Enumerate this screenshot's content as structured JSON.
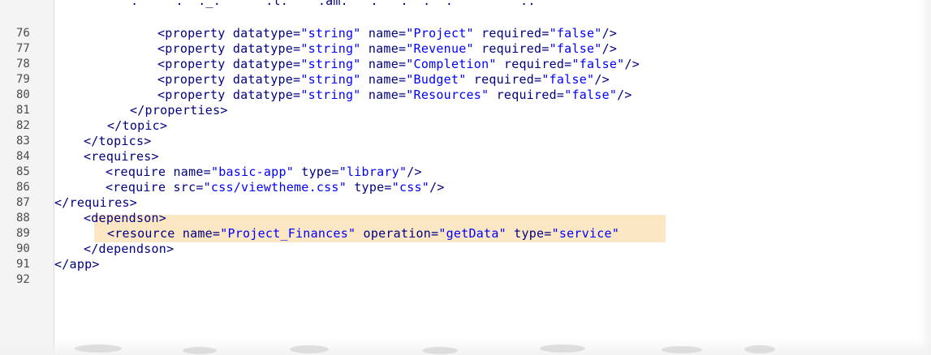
{
  "editor": {
    "clipped_top_line": "     .     .  ._.      .l.    .am.   .   .  .  .         ..",
    "lines": [
      {
        "number": "76",
        "parts": [
          {
            "cls": "tag",
            "text": "<property "
          },
          {
            "cls": "attr",
            "text": "datatype="
          },
          {
            "cls": "val",
            "text": "\"string\""
          },
          {
            "cls": "attr",
            "text": " name="
          },
          {
            "cls": "val",
            "text": "\"Project\""
          },
          {
            "cls": "attr",
            "text": " required="
          },
          {
            "cls": "val",
            "text": "\"false\""
          },
          {
            "cls": "tag",
            "text": "/>"
          }
        ]
      },
      {
        "number": "77",
        "parts": [
          {
            "cls": "tag",
            "text": "<property "
          },
          {
            "cls": "attr",
            "text": "datatype="
          },
          {
            "cls": "val",
            "text": "\"string\""
          },
          {
            "cls": "attr",
            "text": " name="
          },
          {
            "cls": "val",
            "text": "\"Revenue\""
          },
          {
            "cls": "attr",
            "text": " required="
          },
          {
            "cls": "val",
            "text": "\"false\""
          },
          {
            "cls": "tag",
            "text": "/>"
          }
        ]
      },
      {
        "number": "78",
        "parts": [
          {
            "cls": "tag",
            "text": "<property "
          },
          {
            "cls": "attr",
            "text": "datatype="
          },
          {
            "cls": "val",
            "text": "\"string\""
          },
          {
            "cls": "attr",
            "text": " name="
          },
          {
            "cls": "val",
            "text": "\"Completion\""
          },
          {
            "cls": "attr",
            "text": " required="
          },
          {
            "cls": "val",
            "text": "\"false\""
          },
          {
            "cls": "tag",
            "text": "/>"
          }
        ]
      },
      {
        "number": "79",
        "parts": [
          {
            "cls": "tag",
            "text": "<property "
          },
          {
            "cls": "attr",
            "text": "datatype="
          },
          {
            "cls": "val",
            "text": "\"string\""
          },
          {
            "cls": "attr",
            "text": " name="
          },
          {
            "cls": "val",
            "text": "\"Budget\""
          },
          {
            "cls": "attr",
            "text": " required="
          },
          {
            "cls": "val",
            "text": "\"false\""
          },
          {
            "cls": "tag",
            "text": "/>"
          }
        ]
      },
      {
        "number": "80",
        "parts": [
          {
            "cls": "tag",
            "text": "<property "
          },
          {
            "cls": "attr",
            "text": "datatype="
          },
          {
            "cls": "val",
            "text": "\"string\""
          },
          {
            "cls": "attr",
            "text": " name="
          },
          {
            "cls": "val",
            "text": "\"Resources\""
          },
          {
            "cls": "attr",
            "text": " required="
          },
          {
            "cls": "val",
            "text": "\"false\""
          },
          {
            "cls": "tag",
            "text": "/>"
          }
        ]
      },
      {
        "number": "81",
        "parts": [
          {
            "cls": "tag",
            "text": "</properties>"
          }
        ]
      },
      {
        "number": "82",
        "parts": [
          {
            "cls": "tag",
            "text": "</topic>"
          }
        ]
      },
      {
        "number": "83",
        "parts": [
          {
            "cls": "tag",
            "text": "</topics>"
          }
        ]
      },
      {
        "number": "84",
        "parts": [
          {
            "cls": "tag",
            "text": "<requires>"
          }
        ]
      },
      {
        "number": "85",
        "parts": [
          {
            "cls": "tag",
            "text": "<require "
          },
          {
            "cls": "attr",
            "text": "name="
          },
          {
            "cls": "val",
            "text": "\"basic-app\""
          },
          {
            "cls": "attr",
            "text": " type="
          },
          {
            "cls": "val",
            "text": "\"library\""
          },
          {
            "cls": "tag",
            "text": "/>"
          }
        ]
      },
      {
        "number": "86",
        "parts": [
          {
            "cls": "tag",
            "text": "<require "
          },
          {
            "cls": "attr",
            "text": "src="
          },
          {
            "cls": "val",
            "text": "\"css/viewtheme.css\""
          },
          {
            "cls": "attr",
            "text": " type="
          },
          {
            "cls": "val",
            "text": "\"css\""
          },
          {
            "cls": "tag",
            "text": "/>"
          }
        ]
      },
      {
        "number": "87",
        "parts": [
          {
            "cls": "tag",
            "text": "</requires>"
          }
        ]
      },
      {
        "number": "88",
        "parts": [
          {
            "cls": "tag",
            "text": "<dependson>"
          }
        ]
      },
      {
        "number": "89",
        "parts": [
          {
            "cls": "tag",
            "text": "<resource "
          },
          {
            "cls": "attr",
            "text": "name="
          },
          {
            "cls": "val",
            "text": "\"Project_Finances\""
          },
          {
            "cls": "attr",
            "text": " operation="
          },
          {
            "cls": "val",
            "text": "\"getData\""
          },
          {
            "cls": "attr",
            "text": " type="
          },
          {
            "cls": "val",
            "text": "\"service\""
          }
        ]
      },
      {
        "number": "90",
        "parts": [
          {
            "cls": "tag",
            "text": "</dependson>"
          }
        ]
      },
      {
        "number": "91",
        "parts": [
          {
            "cls": "tag",
            "text": "</app>"
          }
        ]
      },
      {
        "number": "92",
        "parts": []
      }
    ]
  },
  "colors": {
    "tag": "#000080",
    "value": "#0000ff",
    "highlight": "#fbe7c4",
    "gutter": "#f4f4f4"
  }
}
